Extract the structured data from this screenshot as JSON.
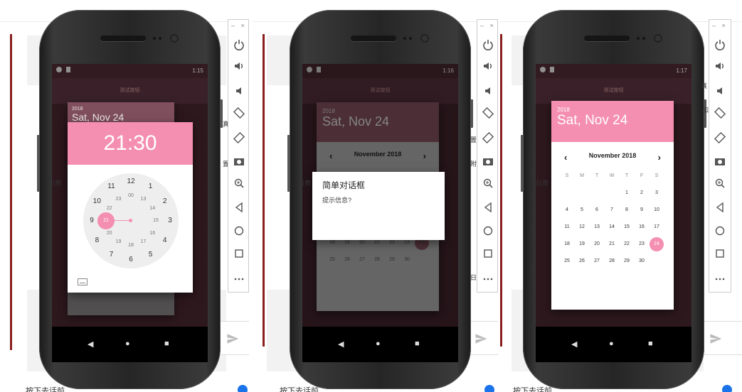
{
  "emulator_controls": {
    "minimize": "–",
    "close": "×"
  },
  "panels": [
    {
      "time": "1:15",
      "app_title": "测试按钮",
      "underlay_year": "2018",
      "underlay_date": "Sat, Nov 24",
      "clock_time": "21:30",
      "outer_numbers": [
        "12",
        "1",
        "2",
        "3",
        "4",
        "5",
        "6",
        "7",
        "8",
        "9",
        "10",
        "11"
      ],
      "inner_numbers": [
        "00",
        "13",
        "14",
        "15",
        "16",
        "17",
        "18",
        "19",
        "20",
        "21",
        "22",
        "23"
      ],
      "selected_hour": "21",
      "left_text": "日费",
      "bottom_text": "按下去话前"
    },
    {
      "time": "1:16",
      "app_title": "测试按钮",
      "year": "2018",
      "date": "Sat, Nov 24",
      "month": "November 2018",
      "dialog_title": "简单对话框",
      "dialog_message": "提示信息?",
      "row5": [
        "18",
        "19",
        "20",
        "21",
        "22",
        "23",
        "24"
      ],
      "row6": [
        "25",
        "26",
        "27",
        "28",
        "29",
        "30"
      ],
      "left_text": "日费",
      "bottom_text": "按下去话前"
    },
    {
      "time": "1:17",
      "app_title": "测试按钮",
      "year": "2018",
      "date": "Sat, Nov 24",
      "month": "November 2018",
      "weekdays": [
        "S",
        "M",
        "T",
        "W",
        "T",
        "F",
        "S"
      ],
      "weeks": [
        [
          "",
          "",
          "",
          "",
          "1",
          "2",
          "3"
        ],
        [
          "4",
          "5",
          "6",
          "7",
          "8",
          "9",
          "10"
        ],
        [
          "11",
          "12",
          "13",
          "14",
          "15",
          "16",
          "17"
        ],
        [
          "18",
          "19",
          "20",
          "21",
          "22",
          "23",
          "24"
        ],
        [
          "25",
          "26",
          "27",
          "28",
          "29",
          "30",
          ""
        ]
      ],
      "selected_day": "24",
      "left_text": "日费",
      "bottom_text": "按下去话前"
    }
  ],
  "side_chars": [
    "真",
    "日",
    "加",
    "置",
    "附",
    "宝",
    "日"
  ],
  "accent": "#f48fb1"
}
